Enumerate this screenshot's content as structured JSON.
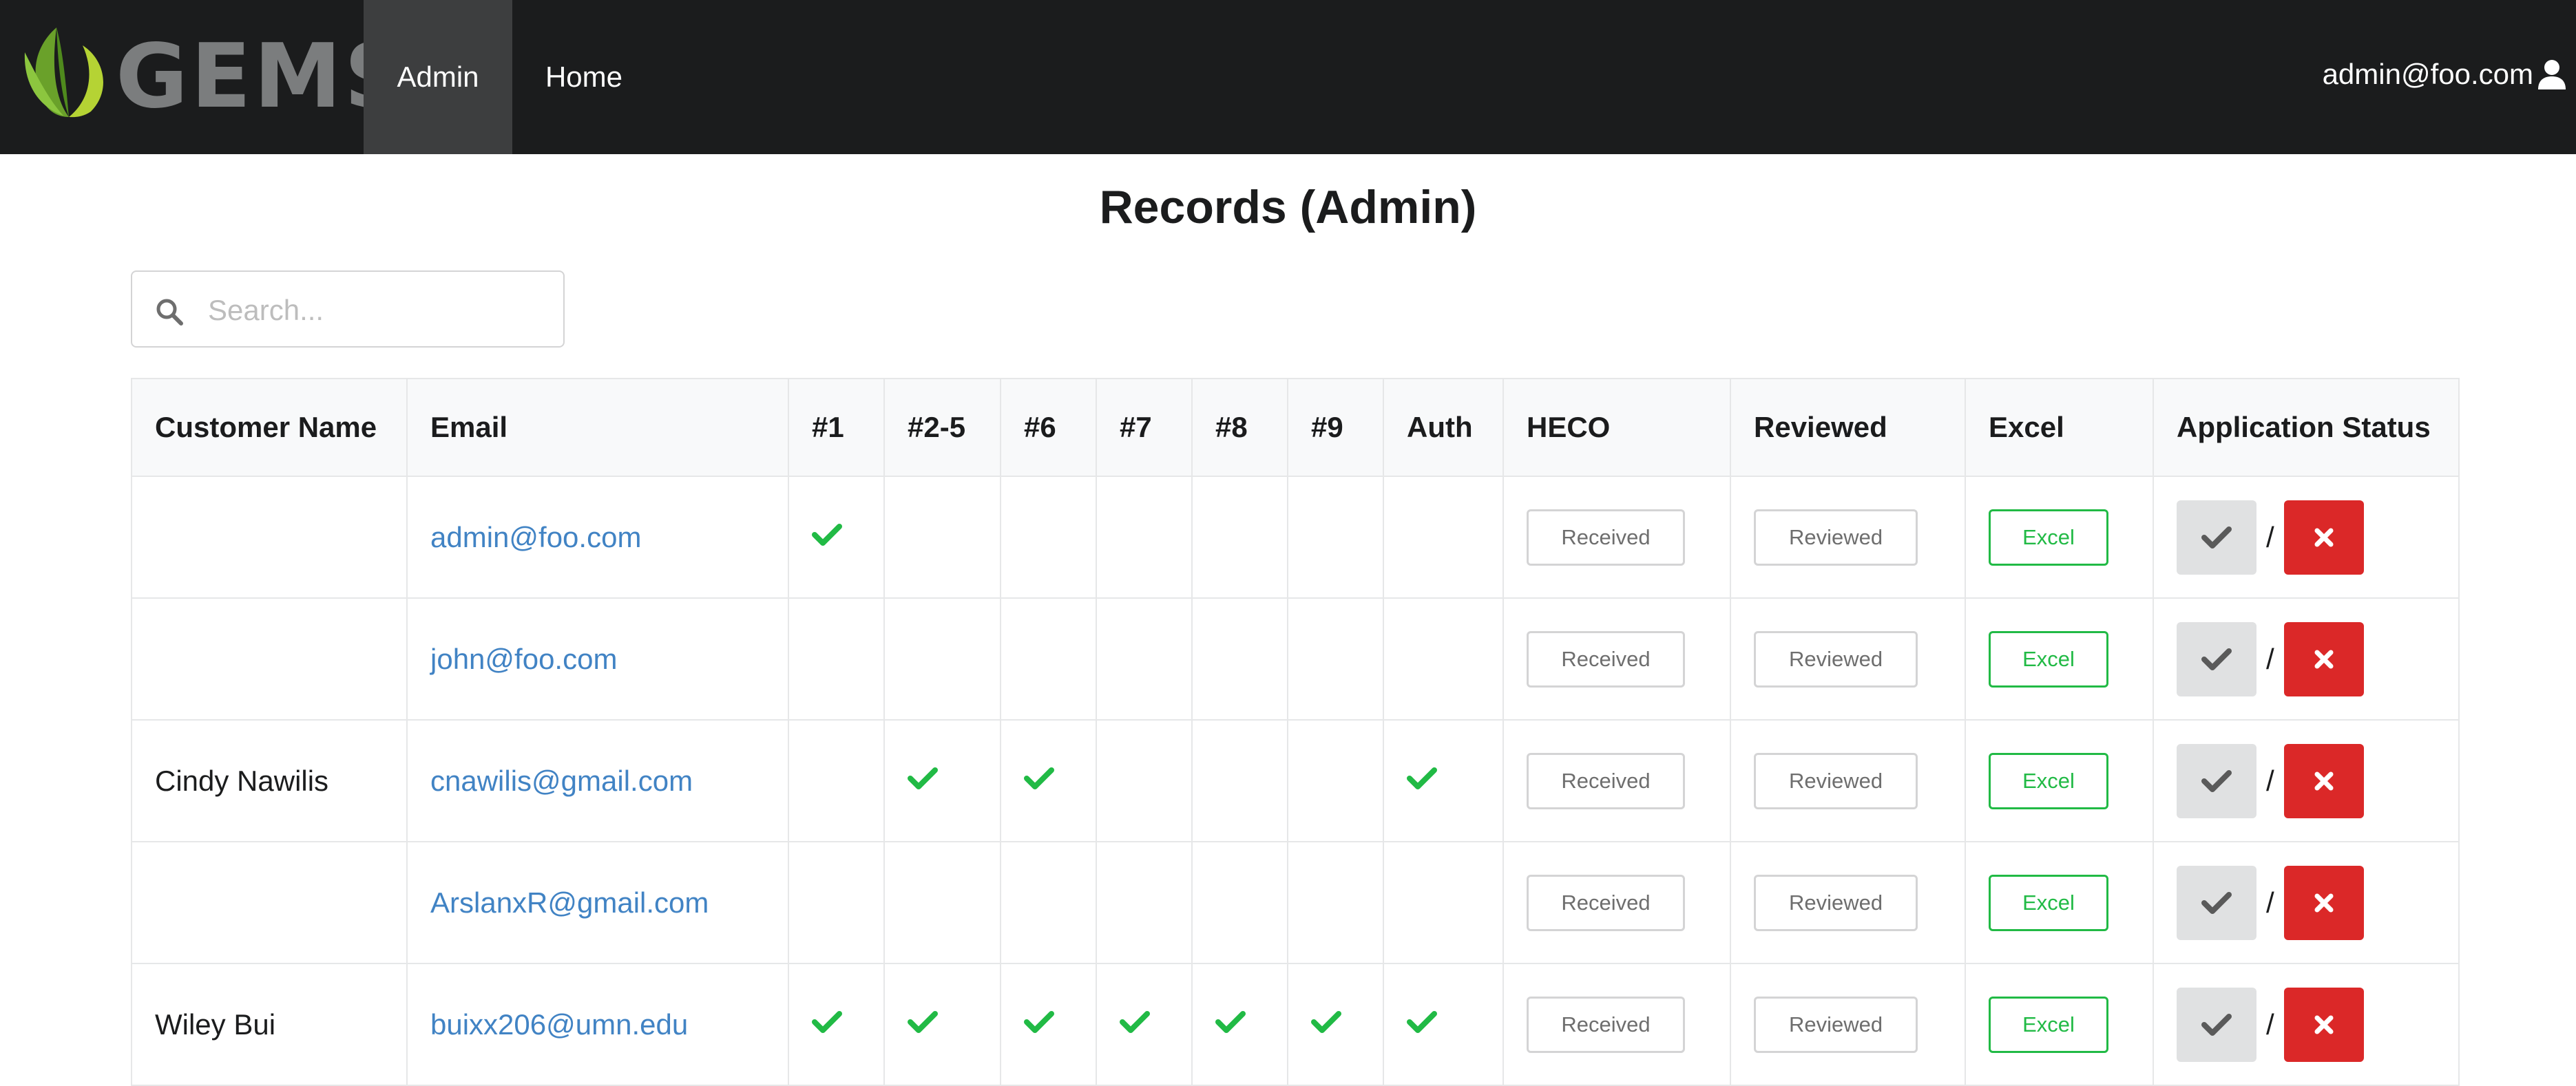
{
  "navbar": {
    "brand": "GEMS",
    "items": [
      {
        "label": "Admin",
        "active": true
      },
      {
        "label": "Home",
        "active": false
      }
    ],
    "user_email": "admin@foo.com",
    "user_icon": "user-icon"
  },
  "page": {
    "title": "Records (Admin)"
  },
  "search": {
    "placeholder": "Search...",
    "value": "",
    "icon": "search-icon"
  },
  "table": {
    "columns": [
      "Customer Name",
      "Email",
      "#1",
      "#2-5",
      "#6",
      "#7",
      "#8",
      "#9",
      "Auth",
      "HECO",
      "Reviewed",
      "Excel",
      "Application Status"
    ],
    "button_labels": {
      "heco": "Received",
      "reviewed": "Reviewed",
      "excel": "Excel",
      "slash": "/"
    },
    "rows": [
      {
        "name": "",
        "email": "admin@foo.com",
        "checks": [
          true,
          false,
          false,
          false,
          false,
          false,
          false
        ]
      },
      {
        "name": "",
        "email": "john@foo.com",
        "checks": [
          false,
          false,
          false,
          false,
          false,
          false,
          false
        ]
      },
      {
        "name": "Cindy Nawilis",
        "email": "cnawilis@gmail.com",
        "checks": [
          false,
          true,
          true,
          false,
          false,
          false,
          true
        ]
      },
      {
        "name": "",
        "email": "ArslanxR@gmail.com",
        "checks": [
          false,
          false,
          false,
          false,
          false,
          false,
          false
        ]
      },
      {
        "name": "Wiley Bui",
        "email": "buixx206@umn.edu",
        "checks": [
          true,
          true,
          true,
          true,
          true,
          true,
          true
        ]
      }
    ]
  },
  "colors": {
    "navbar": "#1b1c1d",
    "nav_active": "#3d3e3f",
    "link": "#4183c4",
    "check": "#21ba45",
    "reject": "#db2828",
    "approve": "#e0e1e2",
    "logo_green": "#8cc63f"
  }
}
